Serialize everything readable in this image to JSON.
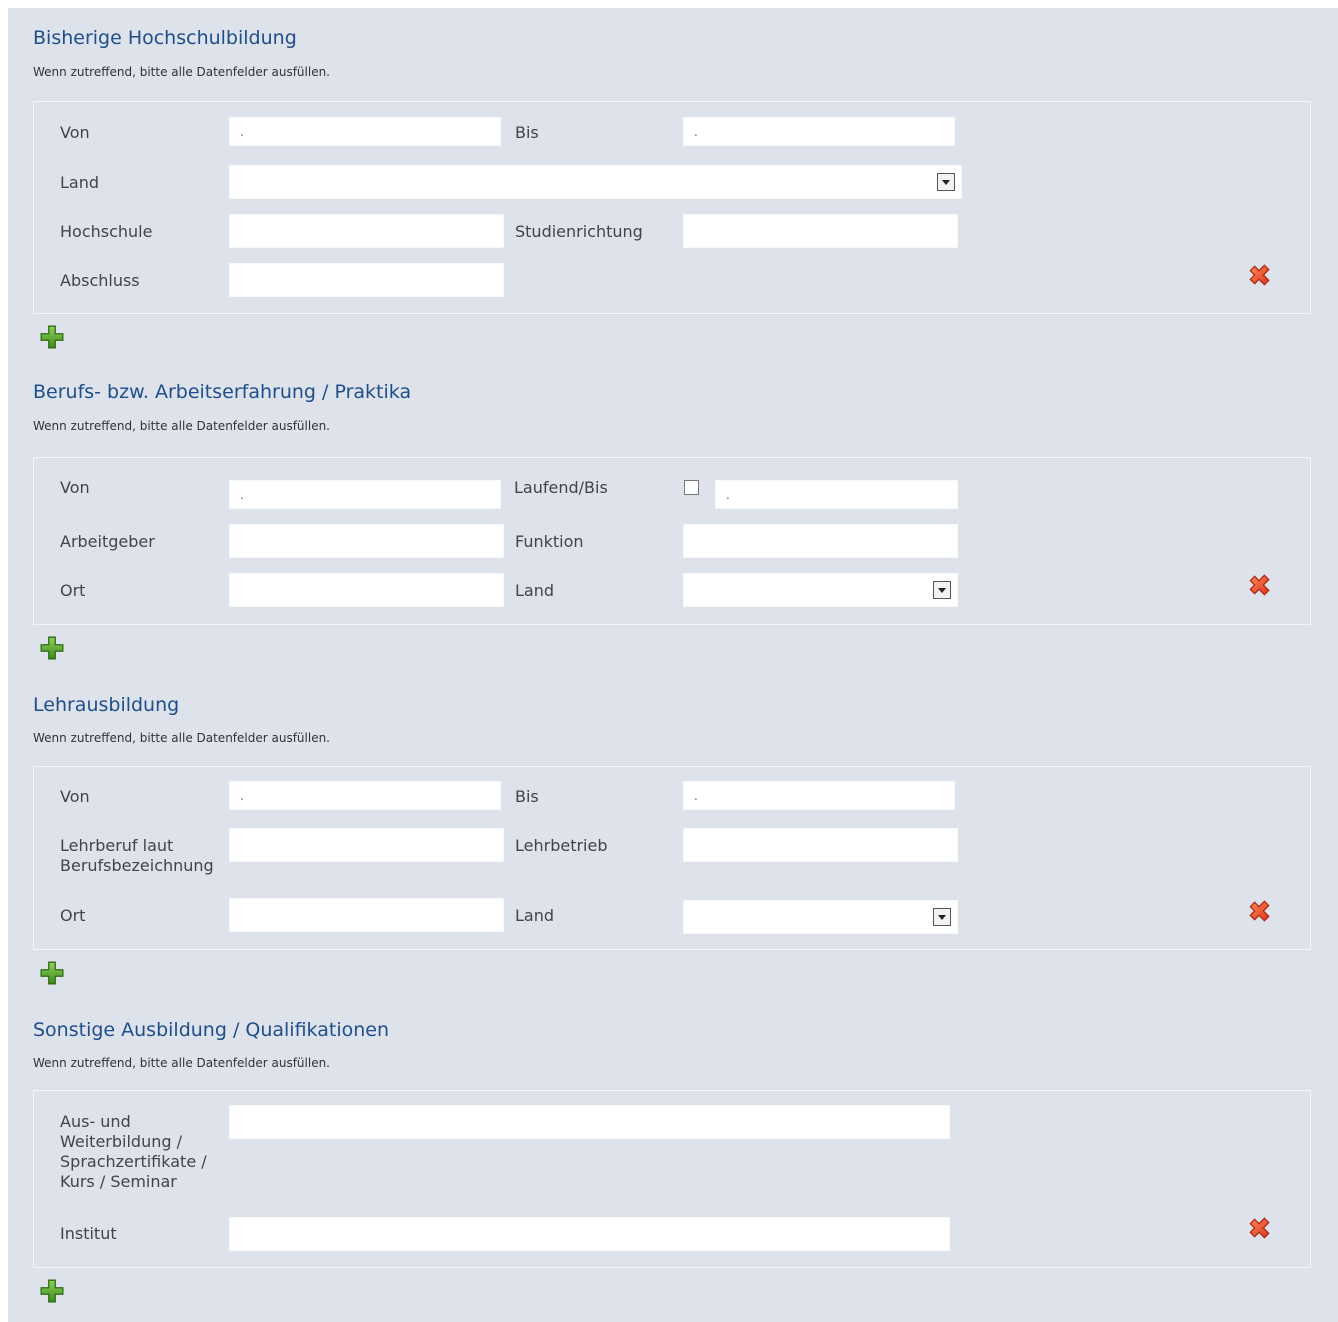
{
  "common": {
    "note": "Wenn zutreffend, bitte alle Datenfelder ausfüllen.",
    "date_placeholder": "."
  },
  "hochschul": {
    "title": "Bisherige Hochschulbildung",
    "von": "Von",
    "bis": "Bis",
    "land": "Land",
    "hochschule": "Hochschule",
    "studienrichtung": "Studienrichtung",
    "abschluss": "Abschluss"
  },
  "beruf": {
    "title": "Berufs- bzw. Arbeitserfahrung / Praktika",
    "von": "Von",
    "laufend_bis": "Laufend/Bis",
    "arbeitgeber": "Arbeitgeber",
    "funktion": "Funktion",
    "ort": "Ort",
    "land": "Land"
  },
  "lehr": {
    "title": "Lehrausbildung",
    "von": "Von",
    "bis": "Bis",
    "lehrberuf_1": "Lehrberuf laut",
    "lehrberuf_2": "Berufsbezeichnung",
    "lehrbetrieb": "Lehrbetrieb",
    "ort": "Ort",
    "land": "Land"
  },
  "sonstige": {
    "title": "Sonstige Ausbildung / Qualifikationen",
    "aus_1": "Aus- und",
    "aus_2": "Weiterbildung /",
    "aus_3": "Sprachzertifikate /",
    "aus_4": "Kurs / Seminar",
    "institut": "Institut"
  },
  "icons": {
    "add": "plus-icon",
    "remove": "delete-x-icon",
    "add_color": "#5a9a2a",
    "remove_color": "#e8552a"
  }
}
